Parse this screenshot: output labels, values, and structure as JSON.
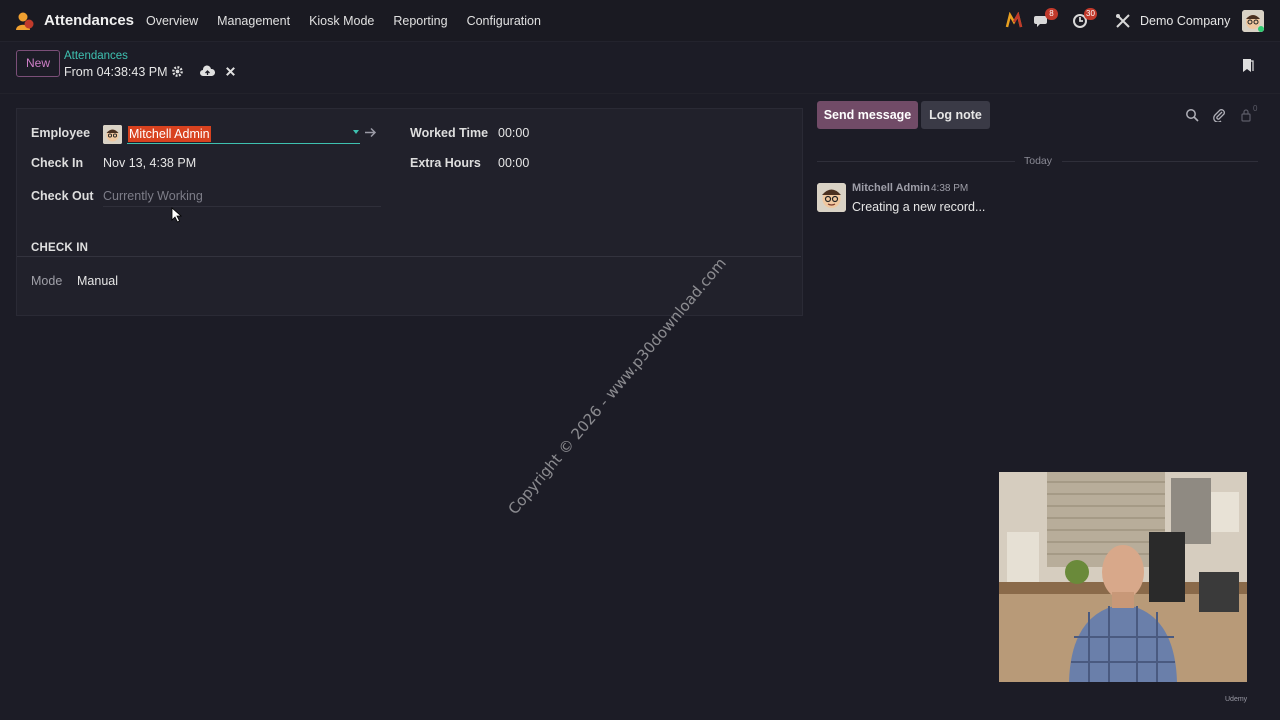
{
  "navbar": {
    "app_name": "Attendances",
    "menu": [
      "Overview",
      "Management",
      "Kiosk Mode",
      "Reporting",
      "Configuration"
    ],
    "messages_badge": "8",
    "activities_badge": "30",
    "company": "Demo Company"
  },
  "control_panel": {
    "new_label": "New",
    "breadcrumb_parent": "Attendances",
    "breadcrumb_current": "From 04:38:43 PM"
  },
  "form": {
    "employee_label": "Employee",
    "employee_value": "Mitchell Admin",
    "check_in_label": "Check In",
    "check_in_value": "Nov 13, 4:38 PM",
    "check_out_label": "Check Out",
    "check_out_placeholder": "Currently Working",
    "worked_time_label": "Worked Time",
    "worked_time_value": "00:00",
    "extra_hours_label": "Extra Hours",
    "extra_hours_value": "00:00",
    "section_title": "CHECK IN",
    "mode_label": "Mode",
    "mode_value": "Manual"
  },
  "chatter": {
    "send_message_label": "Send message",
    "log_note_label": "Log note",
    "followers_count": "0",
    "date_separator": "Today",
    "message": {
      "author": "Mitchell Admin",
      "time": "4:38 PM",
      "body": "Creating a new record..."
    }
  },
  "overlay": {
    "watermark": "Copyright © 2026 - www.p30download.com",
    "brand": "Udemy"
  },
  "colors": {
    "accent": "#714b67",
    "link": "#3ec1b0",
    "selection": "#d8421f",
    "background": "#1c1c26"
  }
}
